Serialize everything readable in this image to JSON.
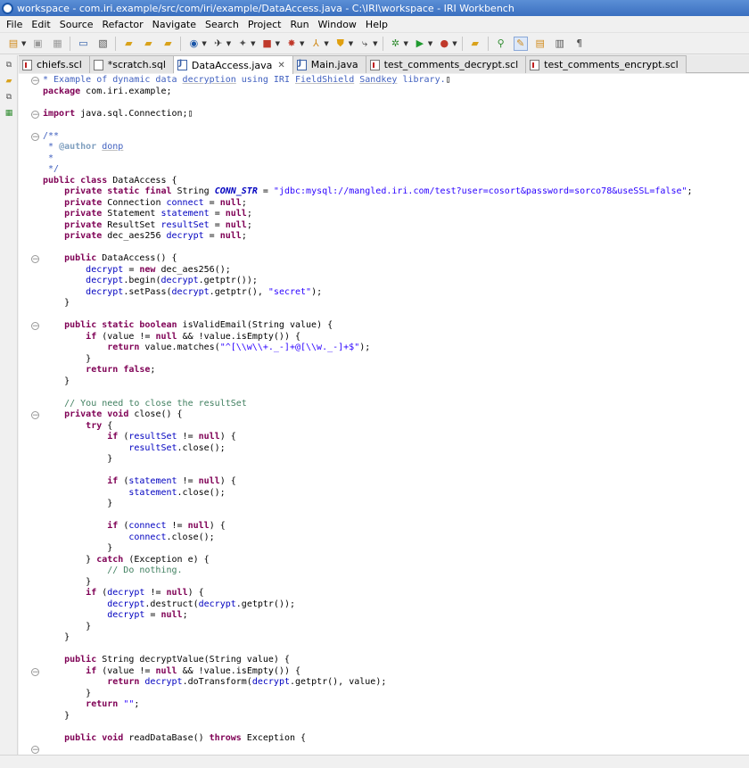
{
  "window": {
    "title": "workspace - com.iri.example/src/com/iri/example/DataAccess.java - C:\\IRI\\workspace - IRI Workbench"
  },
  "menu": [
    "File",
    "Edit",
    "Source",
    "Refactor",
    "Navigate",
    "Search",
    "Project",
    "Run",
    "Window",
    "Help"
  ],
  "tabs": [
    {
      "label": "chiefs.scl",
      "type": "scl"
    },
    {
      "label": "*scratch.sql",
      "type": "sql"
    },
    {
      "label": "DataAccess.java",
      "type": "java",
      "active": true
    },
    {
      "label": "Main.java",
      "type": "java"
    },
    {
      "label": "test_comments_decrypt.scl",
      "type": "scl"
    },
    {
      "label": "test_comments_encrypt.scl",
      "type": "scl"
    }
  ],
  "icons": {
    "tab_close": "close-icon",
    "fold_expanded": "fold-collapse-icon",
    "fold_collapsed": "fold-expand-icon"
  },
  "colors": {
    "keyword": "#7f0055",
    "comment": "#3f7f5f",
    "javadoc": "#3f5fbf",
    "string": "#2a00ff",
    "field": "#0000c0"
  },
  "code_lines": [
    [
      [
        "jd",
        "* Example of dynamic data "
      ],
      [
        "jd ul",
        "decryption"
      ],
      [
        "jd",
        " using IRI "
      ],
      [
        "jd ul",
        "FieldShield"
      ],
      [
        "jd",
        " "
      ],
      [
        "jd ul",
        "Sandkey"
      ],
      [
        "jd",
        " library."
      ],
      [
        "",
        "▯"
      ]
    ],
    [
      [
        "kw",
        "package"
      ],
      [
        "",
        " com.iri.example;"
      ]
    ],
    [],
    [
      [
        "kw",
        "import"
      ],
      [
        "",
        " java.sql.Connection;▯"
      ]
    ],
    [],
    [
      [
        "jd",
        "/**"
      ]
    ],
    [
      [
        "jd",
        " * "
      ],
      [
        "tag",
        "@author"
      ],
      [
        "jd",
        " "
      ],
      [
        "jd ul",
        "donp"
      ]
    ],
    [
      [
        "jd",
        " *"
      ]
    ],
    [
      [
        "jd",
        " */"
      ]
    ],
    [
      [
        "kw",
        "public class"
      ],
      [
        "",
        " DataAccess {"
      ]
    ],
    [
      [
        "",
        "    "
      ],
      [
        "kw",
        "private static final"
      ],
      [
        "",
        " String "
      ],
      [
        "cs",
        "CONN_STR"
      ],
      [
        "",
        " = "
      ],
      [
        "st",
        "\"jdbc:mysql://mangled.iri.com/test?user=cosort&password=sorco78&useSSL=false\""
      ],
      [
        "",
        ";"
      ]
    ],
    [
      [
        "",
        "    "
      ],
      [
        "kw",
        "private"
      ],
      [
        "",
        " Connection "
      ],
      [
        "fd",
        "connect"
      ],
      [
        "",
        " = "
      ],
      [
        "kw",
        "null"
      ],
      [
        "",
        ";"
      ]
    ],
    [
      [
        "",
        "    "
      ],
      [
        "kw",
        "private"
      ],
      [
        "",
        " Statement "
      ],
      [
        "fd",
        "statement"
      ],
      [
        "",
        " = "
      ],
      [
        "kw",
        "null"
      ],
      [
        "",
        ";"
      ]
    ],
    [
      [
        "",
        "    "
      ],
      [
        "kw",
        "private"
      ],
      [
        "",
        " ResultSet "
      ],
      [
        "fd",
        "resultSet"
      ],
      [
        "",
        " = "
      ],
      [
        "kw",
        "null"
      ],
      [
        "",
        ";"
      ]
    ],
    [
      [
        "",
        "    "
      ],
      [
        "kw",
        "private"
      ],
      [
        "",
        " dec_aes256 "
      ],
      [
        "fd",
        "decrypt"
      ],
      [
        "",
        " = "
      ],
      [
        "kw",
        "null"
      ],
      [
        "",
        ";"
      ]
    ],
    [],
    [
      [
        "",
        "    "
      ],
      [
        "kw",
        "public"
      ],
      [
        "",
        " DataAccess() {"
      ]
    ],
    [
      [
        "",
        "        "
      ],
      [
        "fd",
        "decrypt"
      ],
      [
        "",
        " = "
      ],
      [
        "kw",
        "new"
      ],
      [
        "",
        " dec_aes256();"
      ]
    ],
    [
      [
        "",
        "        "
      ],
      [
        "fd",
        "decrypt"
      ],
      [
        "",
        ".begin("
      ],
      [
        "fd",
        "decrypt"
      ],
      [
        "",
        ".getptr());"
      ]
    ],
    [
      [
        "",
        "        "
      ],
      [
        "fd",
        "decrypt"
      ],
      [
        "",
        ".setPass("
      ],
      [
        "fd",
        "decrypt"
      ],
      [
        "",
        ".getptr(), "
      ],
      [
        "st",
        "\"secret\""
      ],
      [
        "",
        ");"
      ]
    ],
    [
      [
        "",
        "    }"
      ]
    ],
    [],
    [
      [
        "",
        "    "
      ],
      [
        "kw",
        "public static boolean"
      ],
      [
        "",
        " isValidEmail(String value) {"
      ]
    ],
    [
      [
        "",
        "        "
      ],
      [
        "kw",
        "if"
      ],
      [
        "",
        " (value != "
      ],
      [
        "kw",
        "null"
      ],
      [
        "",
        " && !value.isEmpty()) {"
      ]
    ],
    [
      [
        "",
        "            "
      ],
      [
        "kw",
        "return"
      ],
      [
        "",
        " value.matches("
      ],
      [
        "st",
        "\"^[\\\\w\\\\+._-]+@[\\\\w._-]+$\""
      ],
      [
        "",
        ");"
      ]
    ],
    [
      [
        "",
        "        }"
      ]
    ],
    [
      [
        "",
        "        "
      ],
      [
        "kw",
        "return false"
      ],
      [
        "",
        ";"
      ]
    ],
    [
      [
        "",
        "    }"
      ]
    ],
    [],
    [
      [
        "",
        "    "
      ],
      [
        "cm",
        "// You need to close the resultSet"
      ]
    ],
    [
      [
        "",
        "    "
      ],
      [
        "kw",
        "private void"
      ],
      [
        "",
        " close() {"
      ]
    ],
    [
      [
        "",
        "        "
      ],
      [
        "kw",
        "try"
      ],
      [
        "",
        " {"
      ]
    ],
    [
      [
        "",
        "            "
      ],
      [
        "kw",
        "if"
      ],
      [
        "",
        " ("
      ],
      [
        "fd",
        "resultSet"
      ],
      [
        "",
        " != "
      ],
      [
        "kw",
        "null"
      ],
      [
        "",
        ") {"
      ]
    ],
    [
      [
        "",
        "                "
      ],
      [
        "fd",
        "resultSet"
      ],
      [
        "",
        ".close();"
      ]
    ],
    [
      [
        "",
        "            }"
      ]
    ],
    [],
    [
      [
        "",
        "            "
      ],
      [
        "kw",
        "if"
      ],
      [
        "",
        " ("
      ],
      [
        "fd",
        "statement"
      ],
      [
        "",
        " != "
      ],
      [
        "kw",
        "null"
      ],
      [
        "",
        ") {"
      ]
    ],
    [
      [
        "",
        "                "
      ],
      [
        "fd",
        "statement"
      ],
      [
        "",
        ".close();"
      ]
    ],
    [
      [
        "",
        "            }"
      ]
    ],
    [],
    [
      [
        "",
        "            "
      ],
      [
        "kw",
        "if"
      ],
      [
        "",
        " ("
      ],
      [
        "fd",
        "connect"
      ],
      [
        "",
        " != "
      ],
      [
        "kw",
        "null"
      ],
      [
        "",
        ") {"
      ]
    ],
    [
      [
        "",
        "                "
      ],
      [
        "fd",
        "connect"
      ],
      [
        "",
        ".close();"
      ]
    ],
    [
      [
        "",
        "            }"
      ]
    ],
    [
      [
        "",
        "        } "
      ],
      [
        "kw",
        "catch"
      ],
      [
        "",
        " (Exception e) {"
      ]
    ],
    [
      [
        "",
        "            "
      ],
      [
        "cm",
        "// Do nothing."
      ]
    ],
    [
      [
        "",
        "        }"
      ]
    ],
    [
      [
        "",
        "        "
      ],
      [
        "kw",
        "if"
      ],
      [
        "",
        " ("
      ],
      [
        "fd",
        "decrypt"
      ],
      [
        "",
        " != "
      ],
      [
        "kw",
        "null"
      ],
      [
        "",
        ") {"
      ]
    ],
    [
      [
        "",
        "            "
      ],
      [
        "fd",
        "decrypt"
      ],
      [
        "",
        ".destruct("
      ],
      [
        "fd",
        "decrypt"
      ],
      [
        "",
        ".getptr());"
      ]
    ],
    [
      [
        "",
        "            "
      ],
      [
        "fd",
        "decrypt"
      ],
      [
        "",
        " = "
      ],
      [
        "kw",
        "null"
      ],
      [
        "",
        ";"
      ]
    ],
    [
      [
        "",
        "        }"
      ]
    ],
    [
      [
        "",
        "    }"
      ]
    ],
    [],
    [
      [
        "",
        "    "
      ],
      [
        "kw",
        "public"
      ],
      [
        "",
        " String decryptValue(String value) {"
      ]
    ],
    [
      [
        "",
        "        "
      ],
      [
        "kw",
        "if"
      ],
      [
        "",
        " (value != "
      ],
      [
        "kw",
        "null"
      ],
      [
        "",
        " && !value.isEmpty()) {"
      ]
    ],
    [
      [
        "",
        "            "
      ],
      [
        "kw",
        "return"
      ],
      [
        "",
        " "
      ],
      [
        "fd",
        "decrypt"
      ],
      [
        "",
        ".doTransform("
      ],
      [
        "fd",
        "decrypt"
      ],
      [
        "",
        ".getptr(), value);"
      ]
    ],
    [
      [
        "",
        "        }"
      ]
    ],
    [
      [
        "",
        "        "
      ],
      [
        "kw",
        "return"
      ],
      [
        "",
        " "
      ],
      [
        "st",
        "\"\""
      ],
      [
        "",
        ";"
      ]
    ],
    [
      [
        "",
        "    }"
      ]
    ],
    [],
    [
      [
        "",
        "    "
      ],
      [
        "kw",
        "public void"
      ],
      [
        "",
        " readDataBase() "
      ],
      [
        "kw",
        "throws"
      ],
      [
        "",
        " Exception {"
      ]
    ]
  ],
  "fold_markers": [
    {
      "line": 0,
      "state": "expanded"
    },
    {
      "line": 3,
      "state": "expanded"
    },
    {
      "line": 5,
      "state": "expanded"
    },
    {
      "line": 16,
      "state": "expanded"
    },
    {
      "line": 22,
      "state": "expanded"
    },
    {
      "line": 30,
      "state": "expanded"
    },
    {
      "line": 53,
      "state": "expanded"
    },
    {
      "line": 60,
      "state": "expanded"
    }
  ]
}
